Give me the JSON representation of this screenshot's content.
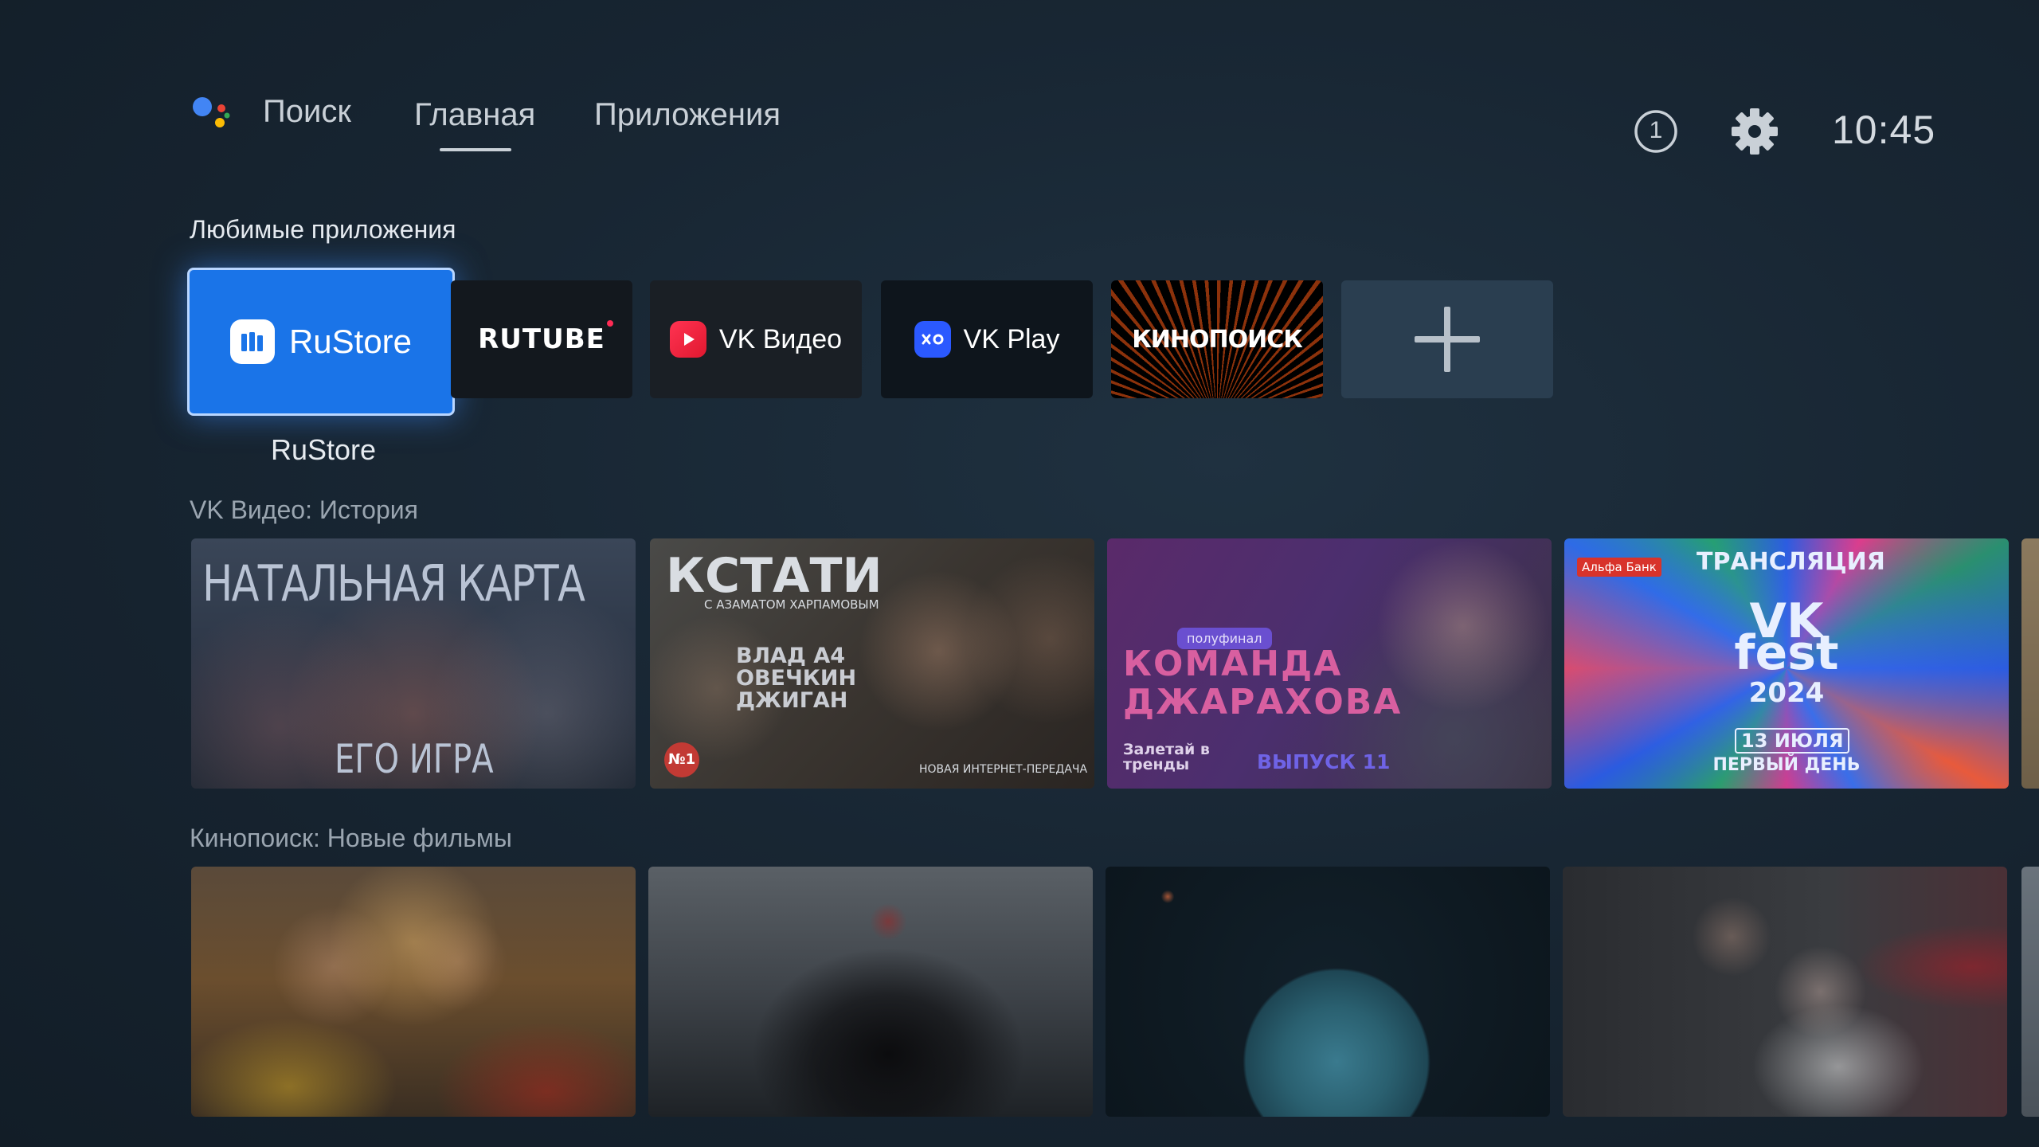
{
  "top_bar": {
    "search_label": "Поиск",
    "tabs": [
      {
        "label": "Главная",
        "selected": true
      },
      {
        "label": "Приложения",
        "selected": false
      }
    ],
    "notification_count": "1",
    "clock": "10:45"
  },
  "favorites": {
    "title": "Любимые приложения",
    "focused_app_label": "RuStore",
    "apps": [
      {
        "name": "RuStore",
        "tile_text": "RuStore"
      },
      {
        "name": "RUTUBE",
        "tile_text": "RUTUBE"
      },
      {
        "name": "VK Видео",
        "tile_text": "VK Видео"
      },
      {
        "name": "VK Play",
        "tile_text": "VK Play"
      },
      {
        "name": "Кинопоиск",
        "tile_text": "КИНОПОИСК"
      }
    ],
    "add_tile_icon": "plus-icon"
  },
  "vk_history": {
    "title": "VK Видео: История",
    "cards": [
      {
        "heading": "НАТАЛЬНАЯ КАРТА",
        "footer": "ЕГО ИГРА"
      },
      {
        "heading": "КСТАТИ",
        "sub": "С АЗАМАТОМ ХАРПАМОВЫМ",
        "names": "ВЛАД А4 ОВЕЧКИН ДЖИГАН",
        "badge": "№1",
        "footer": "НОВАЯ ИНТЕРНЕТ-ПЕРЕДАЧА"
      },
      {
        "badge": "полуфинал",
        "heading": "КОМАНДА ДЖАРАХОВА",
        "side": "Залетай в тренды",
        "footer": "ВЫПУСК 11"
      },
      {
        "brand": "Альфа Банк",
        "heading": "ТРАНСЛЯЦИЯ",
        "logo_line1": "VK",
        "logo_line2": "fest",
        "year": "2024",
        "date": "13 ИЮЛЯ",
        "footer": "ПЕРВЫЙ ДЕНЬ"
      }
    ]
  },
  "kinopoisk_new": {
    "title": "Кинопоиск: Новые фильмы"
  },
  "colors": {
    "background": "#182633",
    "rustore_blue": "#1a74e8",
    "add_tile": "#2a3e50"
  }
}
